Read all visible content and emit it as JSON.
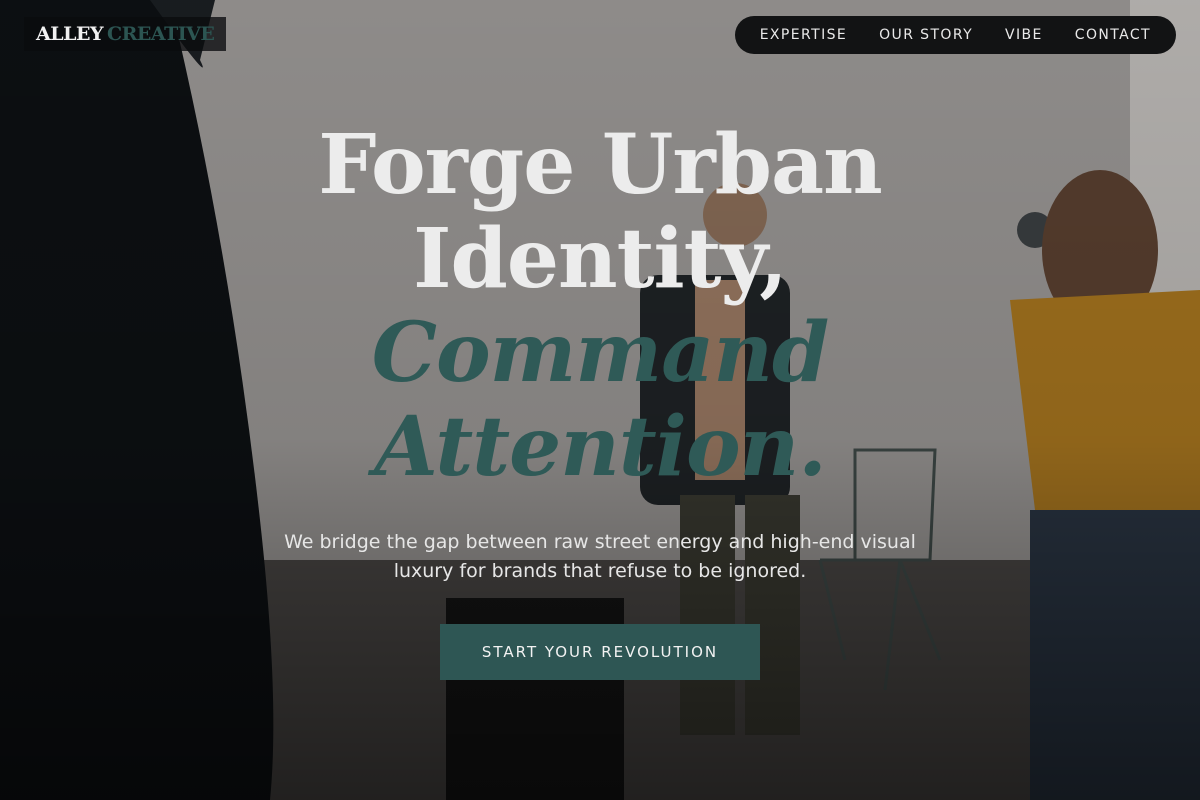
{
  "logo": {
    "word1": "ALLEY",
    "word2": "CREATIVE"
  },
  "nav": {
    "items": [
      "EXPERTISE",
      "OUR STORY",
      "VIBE",
      "CONTACT"
    ]
  },
  "hero": {
    "line1": "Forge Urban",
    "line2": "Identity,",
    "line3": "Command",
    "line4": "Attention.",
    "subtitle_line1": "We bridge the gap between raw street energy and high-end visual",
    "subtitle_line2": "luxury for brands that refuse to be ignored.",
    "cta_label": "START YOUR REVOLUTION"
  },
  "colors": {
    "accent": "#2e5654",
    "nav_bg": "#121314",
    "headline_light": "#ececec"
  }
}
